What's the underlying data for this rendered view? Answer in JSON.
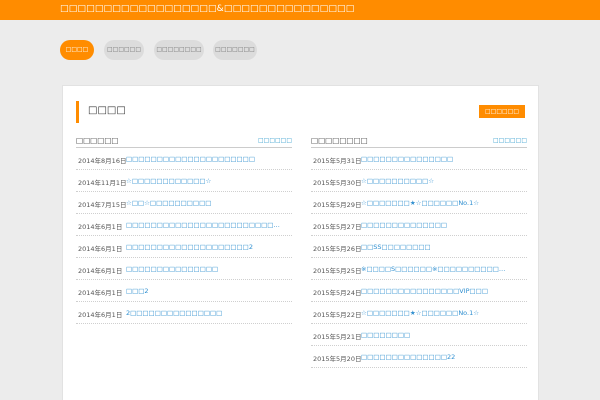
{
  "header": {
    "site_title": "□□□□□□□□□□□□□□□□□□&□□□□□□□□□□□□□□□"
  },
  "nav": [
    {
      "label": "□□□□",
      "active": true
    },
    {
      "label": "□□□□□□",
      "active": false
    },
    {
      "label": "□□□□□□□□",
      "active": false
    },
    {
      "label": "□□□□□□□",
      "active": false
    }
  ],
  "panel": {
    "title": "□□□□",
    "more_label": "□□□□□□"
  },
  "left_column": {
    "title": "□□□□□□",
    "link": "□□□□□□",
    "rows": [
      {
        "date": "2014年8月16日",
        "title": "□□□□□□□□□□□□□□□□□□□□□"
      },
      {
        "date": "2014年11月1日",
        "title": "☆□□□□□□□□□□□□☆"
      },
      {
        "date": "2014年7月15日",
        "title": "☆□□☆□□□□□□□□□□"
      },
      {
        "date": "2014年6月1日",
        "title": "□□□□□□□□□□□□□□□□□□□□□□□□…"
      },
      {
        "date": "2014年6月1日",
        "title": "□□□□□□□□□□□□□□□□□□□□2"
      },
      {
        "date": "2014年6月1日",
        "title": "□□□□□□□□□□□□□□□"
      },
      {
        "date": "2014年6月1日",
        "title": "□□□2"
      },
      {
        "date": "2014年6月1日",
        "title": "2□□□□□□□□□□□□□□□"
      }
    ]
  },
  "right_column": {
    "title": "□□□□□□□□",
    "link": "□□□□□□",
    "rows": [
      {
        "date": "2015年5月31日",
        "title": "□□□□□□□□□□□□□□□"
      },
      {
        "date": "2015年5月30日",
        "title": "☆□□□□□□□□□□☆"
      },
      {
        "date": "2015年5月29日",
        "title": "☆□□□□□□□★☆□□□□□□No.1☆"
      },
      {
        "date": "2015年5月27日",
        "title": "□□□□□□□□□□□□□□"
      },
      {
        "date": "2015年5月26日",
        "title": "□□SS□□□□□□□□"
      },
      {
        "date": "2015年5月25日",
        "title": "※□□□□S□□□□□□※□□□□□□□□□□…"
      },
      {
        "date": "2015年5月24日",
        "title": "□□□□□□□□□□□□□□□□VIP□□□"
      },
      {
        "date": "2015年5月22日",
        "title": "☆□□□□□□□★☆□□□□□□No.1☆"
      },
      {
        "date": "2015年5月21日",
        "title": "□□□□□□□□"
      },
      {
        "date": "2015年5月20日",
        "title": "□□□□□□□□□□□□□□22"
      }
    ]
  },
  "colors": {
    "accent": "#ff8c00",
    "link": "#2f8fd0",
    "background": "#ececec"
  }
}
